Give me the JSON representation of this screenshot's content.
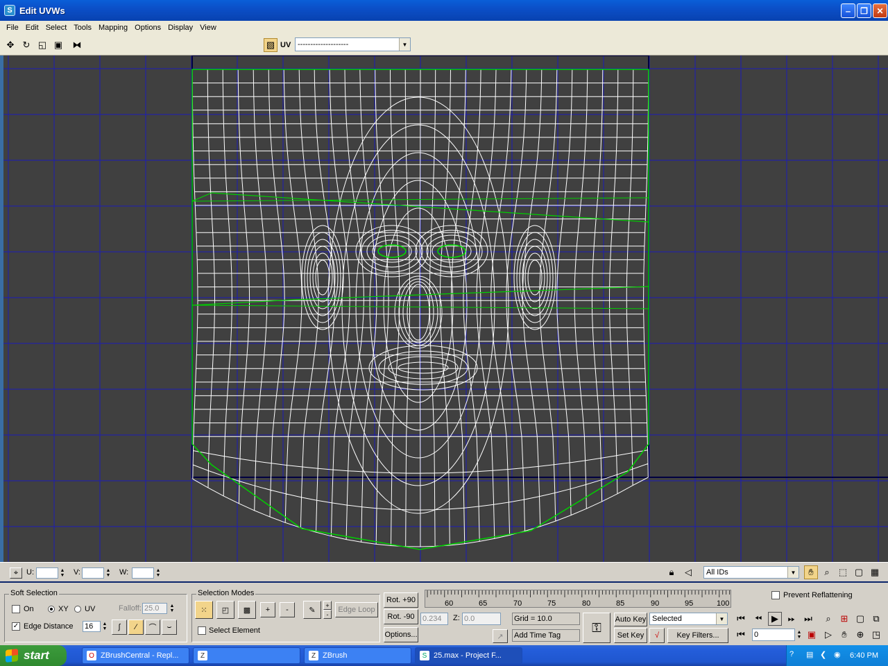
{
  "window": {
    "title": "Edit UVWs"
  },
  "menu": [
    "File",
    "Edit",
    "Select",
    "Tools",
    "Mapping",
    "Options",
    "Display",
    "View"
  ],
  "toolbar": {
    "uv_label": "UV",
    "map_combo": "--------------------"
  },
  "uvw": {
    "u_label": "U:",
    "v_label": "V:",
    "w_label": "W:",
    "ids_combo": "All IDs"
  },
  "soft_selection": {
    "title": "Soft Selection",
    "on_label": "On",
    "xy_label": "XY",
    "uv_label": "UV",
    "falloff_label": "Falloff:",
    "falloff_value": "25.0",
    "edge_distance_label": "Edge Distance",
    "edge_distance_value": "16"
  },
  "selection_modes": {
    "title": "Selection Modes",
    "plus": "+",
    "minus": "-",
    "edge_loop": "Edge Loop",
    "select_element": "Select Element"
  },
  "rotate": {
    "plus90": "Rot. +90",
    "minus90": "Rot. -90",
    "options": "Options..."
  },
  "timeline": {
    "ticks": [
      "60",
      "65",
      "70",
      "75",
      "80",
      "85",
      "90",
      "95",
      "100"
    ]
  },
  "coords": {
    "x_value": "0.234",
    "z_label": "Z:",
    "z_value": "0.0",
    "grid": "Grid = 10.0",
    "add_time_tag": "Add Time Tag"
  },
  "anim": {
    "auto_key": "Auto Key",
    "set_key": "Set Key",
    "selected": "Selected",
    "key_filters": "Key Filters...",
    "frame": "0"
  },
  "prevent_reflattening": "Prevent Reflattening",
  "taskbar": {
    "start": "start",
    "tasks": [
      "ZBrushCentral - Repl...",
      "",
      "ZBrush",
      "25.max      - Project F..."
    ],
    "clock": "6:40 PM"
  }
}
